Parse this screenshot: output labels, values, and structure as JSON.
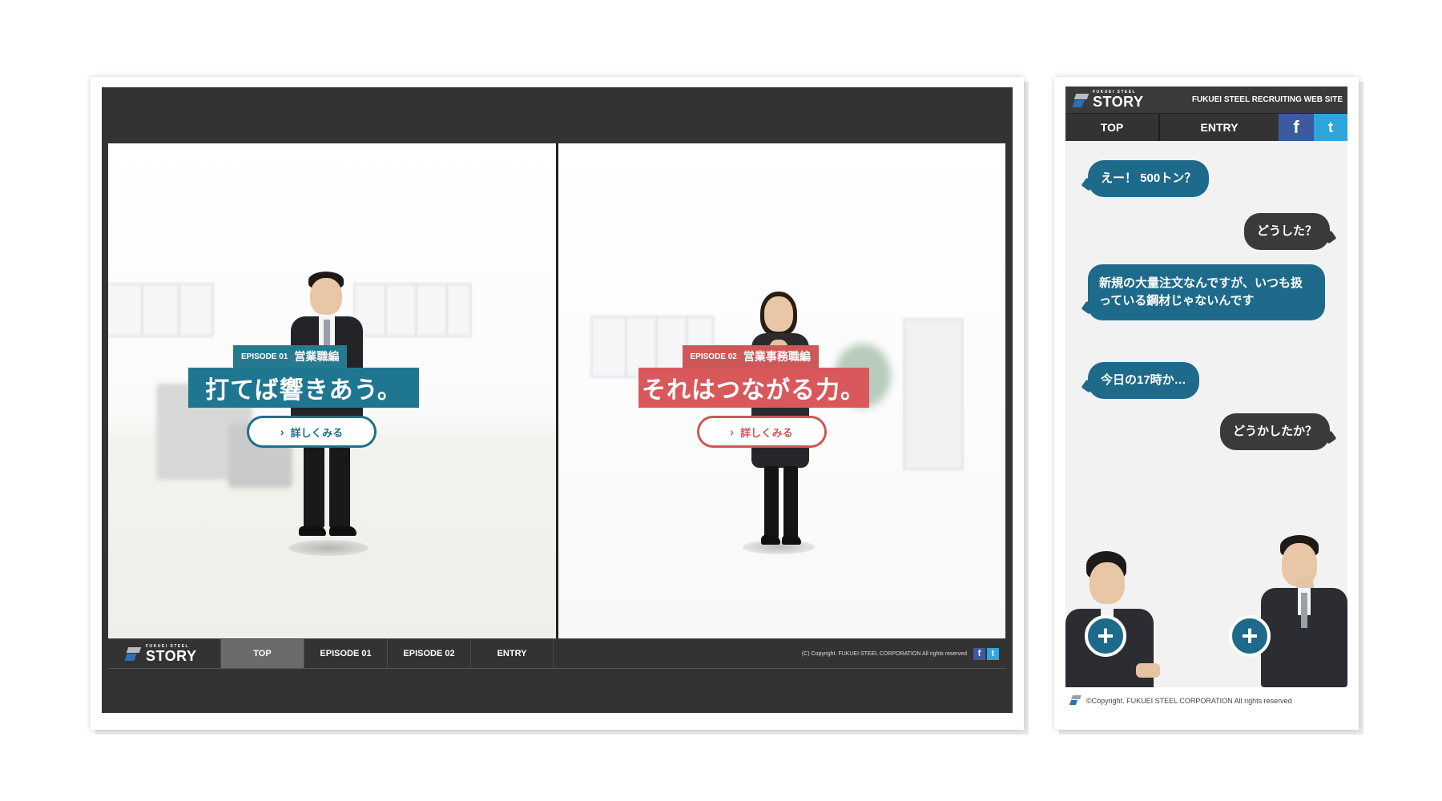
{
  "desktop": {
    "episodes": [
      {
        "episode": "EPISODE 01",
        "department": "営業職編",
        "headline": "打てば響きあう。",
        "button": "詳しくみる",
        "color": "#1f7690"
      },
      {
        "episode": "EPISODE 02",
        "department": "営業事務職編",
        "headline": "それはつながる力。",
        "button": "詳しくみる",
        "color": "#d9585b"
      }
    ],
    "nav": {
      "logo_small": "FUKUEI STEEL",
      "logo_big": "STORY",
      "items": [
        "TOP",
        "EPISODE 01",
        "EPISODE 02",
        "ENTRY"
      ],
      "active": "TOP",
      "copyright": "(C) Copyright. FUKUEI STEEL CORPORATION All rights reserved",
      "facebook": "f",
      "twitter": "t"
    }
  },
  "mobile": {
    "header": {
      "logo_small": "FUKUEI STEEL",
      "logo_big": "STORY",
      "site_title": "FUKUEI STEEL RECRUITING WEB SITE",
      "nav": [
        "TOP",
        "ENTRY"
      ],
      "facebook": "f",
      "twitter": "t"
    },
    "chat": [
      {
        "speaker": "left",
        "text": "えー！ 500トン？"
      },
      {
        "speaker": "right",
        "text": "どうした？"
      },
      {
        "speaker": "left",
        "text": "新規の大量注文なんですが、いつも扱っている鋼材じゃないんです"
      },
      {
        "speaker": "left",
        "text": "今日の17時か…"
      },
      {
        "speaker": "right",
        "text": "どうかしたか？"
      }
    ],
    "plus_label": "+",
    "footer": "©Copyright. FUKUEI STEEL CORPORATION All rights reserved"
  },
  "colors": {
    "blue_accent": "#1e6a8a",
    "red_accent": "#d9585b",
    "dark_bg": "#333333",
    "facebook": "#3b5aa0",
    "twitter": "#2fa5dc"
  }
}
